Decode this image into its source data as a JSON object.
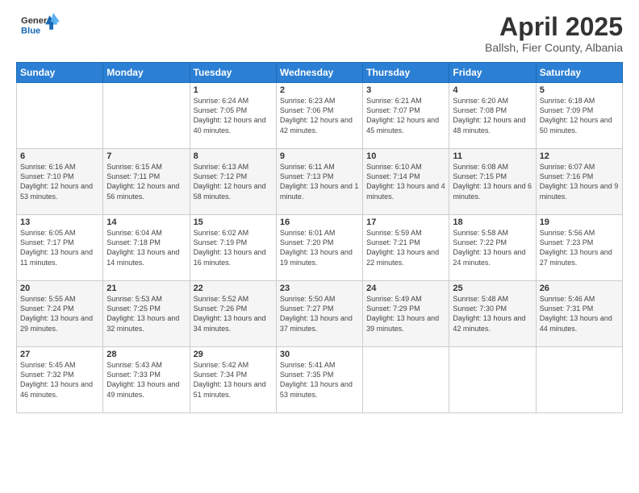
{
  "logo": {
    "line1": "General",
    "line2": "Blue"
  },
  "title": "April 2025",
  "subtitle": "Ballsh, Fier County, Albania",
  "weekdays": [
    "Sunday",
    "Monday",
    "Tuesday",
    "Wednesday",
    "Thursday",
    "Friday",
    "Saturday"
  ],
  "weeks": [
    [
      {
        "day": "",
        "info": ""
      },
      {
        "day": "",
        "info": ""
      },
      {
        "day": "1",
        "info": "Sunrise: 6:24 AM\nSunset: 7:05 PM\nDaylight: 12 hours and 40 minutes."
      },
      {
        "day": "2",
        "info": "Sunrise: 6:23 AM\nSunset: 7:06 PM\nDaylight: 12 hours and 42 minutes."
      },
      {
        "day": "3",
        "info": "Sunrise: 6:21 AM\nSunset: 7:07 PM\nDaylight: 12 hours and 45 minutes."
      },
      {
        "day": "4",
        "info": "Sunrise: 6:20 AM\nSunset: 7:08 PM\nDaylight: 12 hours and 48 minutes."
      },
      {
        "day": "5",
        "info": "Sunrise: 6:18 AM\nSunset: 7:09 PM\nDaylight: 12 hours and 50 minutes."
      }
    ],
    [
      {
        "day": "6",
        "info": "Sunrise: 6:16 AM\nSunset: 7:10 PM\nDaylight: 12 hours and 53 minutes."
      },
      {
        "day": "7",
        "info": "Sunrise: 6:15 AM\nSunset: 7:11 PM\nDaylight: 12 hours and 56 minutes."
      },
      {
        "day": "8",
        "info": "Sunrise: 6:13 AM\nSunset: 7:12 PM\nDaylight: 12 hours and 58 minutes."
      },
      {
        "day": "9",
        "info": "Sunrise: 6:11 AM\nSunset: 7:13 PM\nDaylight: 13 hours and 1 minute."
      },
      {
        "day": "10",
        "info": "Sunrise: 6:10 AM\nSunset: 7:14 PM\nDaylight: 13 hours and 4 minutes."
      },
      {
        "day": "11",
        "info": "Sunrise: 6:08 AM\nSunset: 7:15 PM\nDaylight: 13 hours and 6 minutes."
      },
      {
        "day": "12",
        "info": "Sunrise: 6:07 AM\nSunset: 7:16 PM\nDaylight: 13 hours and 9 minutes."
      }
    ],
    [
      {
        "day": "13",
        "info": "Sunrise: 6:05 AM\nSunset: 7:17 PM\nDaylight: 13 hours and 11 minutes."
      },
      {
        "day": "14",
        "info": "Sunrise: 6:04 AM\nSunset: 7:18 PM\nDaylight: 13 hours and 14 minutes."
      },
      {
        "day": "15",
        "info": "Sunrise: 6:02 AM\nSunset: 7:19 PM\nDaylight: 13 hours and 16 minutes."
      },
      {
        "day": "16",
        "info": "Sunrise: 6:01 AM\nSunset: 7:20 PM\nDaylight: 13 hours and 19 minutes."
      },
      {
        "day": "17",
        "info": "Sunrise: 5:59 AM\nSunset: 7:21 PM\nDaylight: 13 hours and 22 minutes."
      },
      {
        "day": "18",
        "info": "Sunrise: 5:58 AM\nSunset: 7:22 PM\nDaylight: 13 hours and 24 minutes."
      },
      {
        "day": "19",
        "info": "Sunrise: 5:56 AM\nSunset: 7:23 PM\nDaylight: 13 hours and 27 minutes."
      }
    ],
    [
      {
        "day": "20",
        "info": "Sunrise: 5:55 AM\nSunset: 7:24 PM\nDaylight: 13 hours and 29 minutes."
      },
      {
        "day": "21",
        "info": "Sunrise: 5:53 AM\nSunset: 7:25 PM\nDaylight: 13 hours and 32 minutes."
      },
      {
        "day": "22",
        "info": "Sunrise: 5:52 AM\nSunset: 7:26 PM\nDaylight: 13 hours and 34 minutes."
      },
      {
        "day": "23",
        "info": "Sunrise: 5:50 AM\nSunset: 7:27 PM\nDaylight: 13 hours and 37 minutes."
      },
      {
        "day": "24",
        "info": "Sunrise: 5:49 AM\nSunset: 7:29 PM\nDaylight: 13 hours and 39 minutes."
      },
      {
        "day": "25",
        "info": "Sunrise: 5:48 AM\nSunset: 7:30 PM\nDaylight: 13 hours and 42 minutes."
      },
      {
        "day": "26",
        "info": "Sunrise: 5:46 AM\nSunset: 7:31 PM\nDaylight: 13 hours and 44 minutes."
      }
    ],
    [
      {
        "day": "27",
        "info": "Sunrise: 5:45 AM\nSunset: 7:32 PM\nDaylight: 13 hours and 46 minutes."
      },
      {
        "day": "28",
        "info": "Sunrise: 5:43 AM\nSunset: 7:33 PM\nDaylight: 13 hours and 49 minutes."
      },
      {
        "day": "29",
        "info": "Sunrise: 5:42 AM\nSunset: 7:34 PM\nDaylight: 13 hours and 51 minutes."
      },
      {
        "day": "30",
        "info": "Sunrise: 5:41 AM\nSunset: 7:35 PM\nDaylight: 13 hours and 53 minutes."
      },
      {
        "day": "",
        "info": ""
      },
      {
        "day": "",
        "info": ""
      },
      {
        "day": "",
        "info": ""
      }
    ]
  ]
}
